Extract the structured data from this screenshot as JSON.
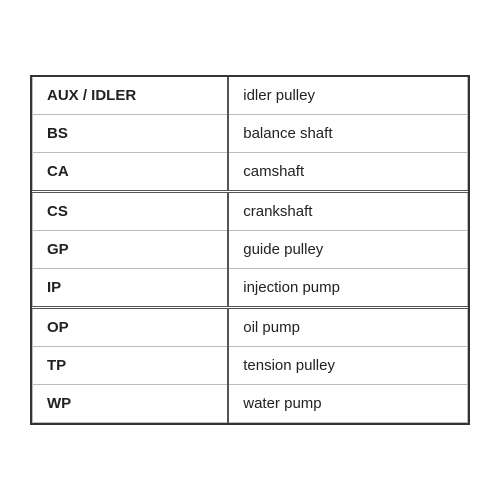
{
  "table": {
    "rows": [
      {
        "abbr": "AUX / IDLER",
        "description": "idler pulley",
        "groupBreak": false
      },
      {
        "abbr": "BS",
        "description": "balance shaft",
        "groupBreak": false
      },
      {
        "abbr": "CA",
        "description": "camshaft",
        "groupBreak": false
      },
      {
        "abbr": "CS",
        "description": "crankshaft",
        "groupBreak": true
      },
      {
        "abbr": "GP",
        "description": "guide pulley",
        "groupBreak": false
      },
      {
        "abbr": "IP",
        "description": "injection pump",
        "groupBreak": false
      },
      {
        "abbr": "OP",
        "description": "oil pump",
        "groupBreak": true
      },
      {
        "abbr": "TP",
        "description": "tension pulley",
        "groupBreak": false
      },
      {
        "abbr": "WP",
        "description": "water pump",
        "groupBreak": false
      }
    ]
  }
}
